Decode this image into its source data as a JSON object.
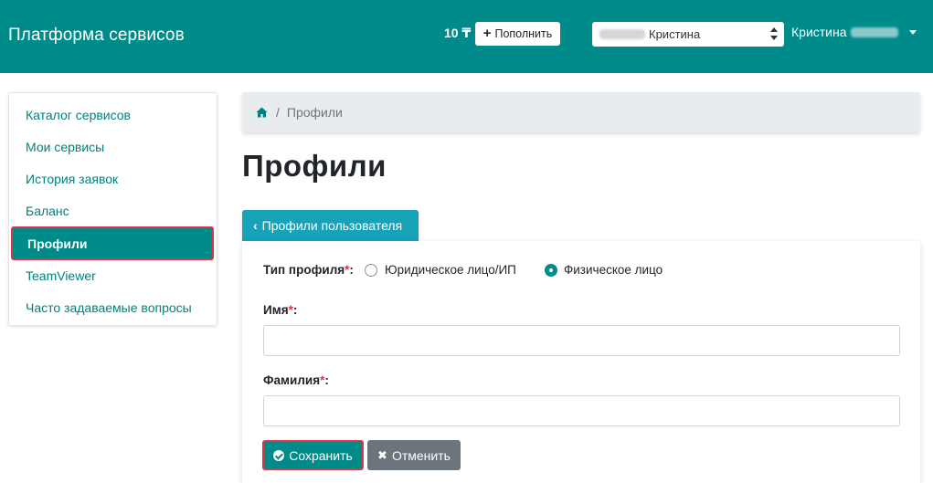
{
  "header": {
    "brand": "Платформа сервисов",
    "balance": "10 ₸",
    "topup_label": "Пополнить",
    "profile_select_value": "Кристина",
    "user_name": "Кристина",
    "bg_color": "#008b8b"
  },
  "sidebar": {
    "items": [
      {
        "label": "Каталог сервисов",
        "active": false
      },
      {
        "label": "Мои сервисы",
        "active": false
      },
      {
        "label": "История заявок",
        "active": false
      },
      {
        "label": "Баланс",
        "active": false
      },
      {
        "label": "Профили",
        "active": true
      },
      {
        "label": "TeamViewer",
        "active": false
      },
      {
        "label": "Часто задаваемые вопросы",
        "active": false
      }
    ]
  },
  "breadcrumb": {
    "home_icon": "home-icon",
    "separator": "/",
    "current": "Профили"
  },
  "page": {
    "title": "Профили",
    "back_button": "Профили пользователя"
  },
  "form": {
    "profile_type_label": "Тип профиля",
    "required_mark": "*",
    "label_colon": ":",
    "options": [
      {
        "label": "Юридическое лицо/ИП",
        "checked": false
      },
      {
        "label": "Физическое лицо",
        "checked": true
      }
    ],
    "first_name_label": "Имя",
    "first_name_value": "",
    "last_name_label": "Фамилия",
    "last_name_value": "",
    "save_label": "Сохранить",
    "cancel_label": "Отменить"
  }
}
